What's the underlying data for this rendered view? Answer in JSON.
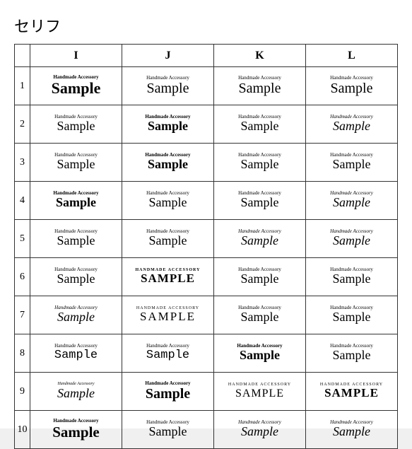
{
  "page": {
    "title": "セリフ",
    "table": {
      "col_headers": [
        "",
        "I",
        "J",
        "K",
        "L"
      ],
      "rows": [
        {
          "num": "1",
          "cells": [
            {
              "top": "Handmade Accessory",
              "bottom": "Sample",
              "style": "r1i"
            },
            {
              "top": "Handmade Accessory",
              "bottom": "Sample",
              "style": "r1j"
            },
            {
              "top": "Handmade Accessory",
              "bottom": "Sample",
              "style": "r1k"
            },
            {
              "top": "Handmade Accessory",
              "bottom": "Sample",
              "style": "r1l"
            }
          ]
        },
        {
          "num": "2",
          "cells": [
            {
              "top": "Handmade Accessory",
              "bottom": "Sample",
              "style": "r2i"
            },
            {
              "top": "Handmade Accessory",
              "bottom": "Sample",
              "style": "r2j"
            },
            {
              "top": "Handmade Accessory",
              "bottom": "Sample",
              "style": "r2k"
            },
            {
              "top": "Handmade Accessory",
              "bottom": "Sample",
              "style": "r2l"
            }
          ]
        },
        {
          "num": "3",
          "cells": [
            {
              "top": "Handmade Accessory",
              "bottom": "Sample",
              "style": "r3i"
            },
            {
              "top": "Handmade Accessory",
              "bottom": "Sample",
              "style": "r3j"
            },
            {
              "top": "Handmade Accessory",
              "bottom": "Sample",
              "style": "r3k"
            },
            {
              "top": "Handmade Accessory",
              "bottom": "Sample",
              "style": "r3l"
            }
          ]
        },
        {
          "num": "4",
          "cells": [
            {
              "top": "Handmade Accessory",
              "bottom": "Sample",
              "style": "r4i"
            },
            {
              "top": "Handmade Accessory",
              "bottom": "Sample",
              "style": "r4j"
            },
            {
              "top": "Handmade Accessory",
              "bottom": "Sample",
              "style": "r4k"
            },
            {
              "top": "Handmade Accessory",
              "bottom": "Sample",
              "style": "r4l"
            }
          ]
        },
        {
          "num": "5",
          "cells": [
            {
              "top": "Handmade Accessory",
              "bottom": "Sample",
              "style": "r5i"
            },
            {
              "top": "Handmade Accessory",
              "bottom": "Sample",
              "style": "r5j"
            },
            {
              "top": "Handmade Accessory",
              "bottom": "Sample",
              "style": "r5k"
            },
            {
              "top": "Handmade Accessory",
              "bottom": "Sample",
              "style": "r5l"
            }
          ]
        },
        {
          "num": "6",
          "cells": [
            {
              "top": "Handmade Accessory",
              "bottom": "Sample",
              "style": "r6i"
            },
            {
              "top": "HANDMADE ACCESSORY",
              "bottom": "SAMPLE",
              "style": "r6j"
            },
            {
              "top": "Handmade Accessory",
              "bottom": "Sample",
              "style": "r6k"
            },
            {
              "top": "Handmade Accessory",
              "bottom": "Sample",
              "style": "r6l"
            }
          ]
        },
        {
          "num": "7",
          "cells": [
            {
              "top": "Handmade Accessory",
              "bottom": "Sample",
              "style": "r7i"
            },
            {
              "top": "HANDMADE ACCESSORY",
              "bottom": "SAMPLE",
              "style": "r7j"
            },
            {
              "top": "Handmade Accessory",
              "bottom": "Sample",
              "style": "r7k"
            },
            {
              "top": "Handmade Accessory",
              "bottom": "Sample",
              "style": "r7l"
            }
          ]
        },
        {
          "num": "8",
          "cells": [
            {
              "top": "Handmade Accessory",
              "bottom": "Sample",
              "style": "r8i"
            },
            {
              "top": "Handmade Accessory",
              "bottom": "Sample",
              "style": "r8j"
            },
            {
              "top": "Handmade Accessory",
              "bottom": "Sample",
              "style": "r8k"
            },
            {
              "top": "Handmade Accessory",
              "bottom": "Sample",
              "style": "r8l"
            }
          ]
        },
        {
          "num": "9",
          "cells": [
            {
              "top": "Handmade Accessory",
              "bottom": "Sample",
              "style": "r9i"
            },
            {
              "top": "Handmade Accessory",
              "bottom": "Sample",
              "style": "r9j"
            },
            {
              "top": "HANDMADE ACCESSORY",
              "bottom": "SAMPLE",
              "style": "r9k"
            },
            {
              "top": "HANDMADE ACCESSORY",
              "bottom": "SAMPLE",
              "style": "r9l"
            }
          ]
        },
        {
          "num": "10",
          "cells": [
            {
              "top": "Handmade Accessory",
              "bottom": "Sample",
              "style": "r10i"
            },
            {
              "top": "Handmade Accessory",
              "bottom": "Sample",
              "style": "r10j"
            },
            {
              "top": "Handmade Accessory",
              "bottom": "Sample",
              "style": "r10k"
            },
            {
              "top": "Handmade Accessory",
              "bottom": "Sample",
              "style": "r10l"
            }
          ]
        }
      ]
    }
  }
}
